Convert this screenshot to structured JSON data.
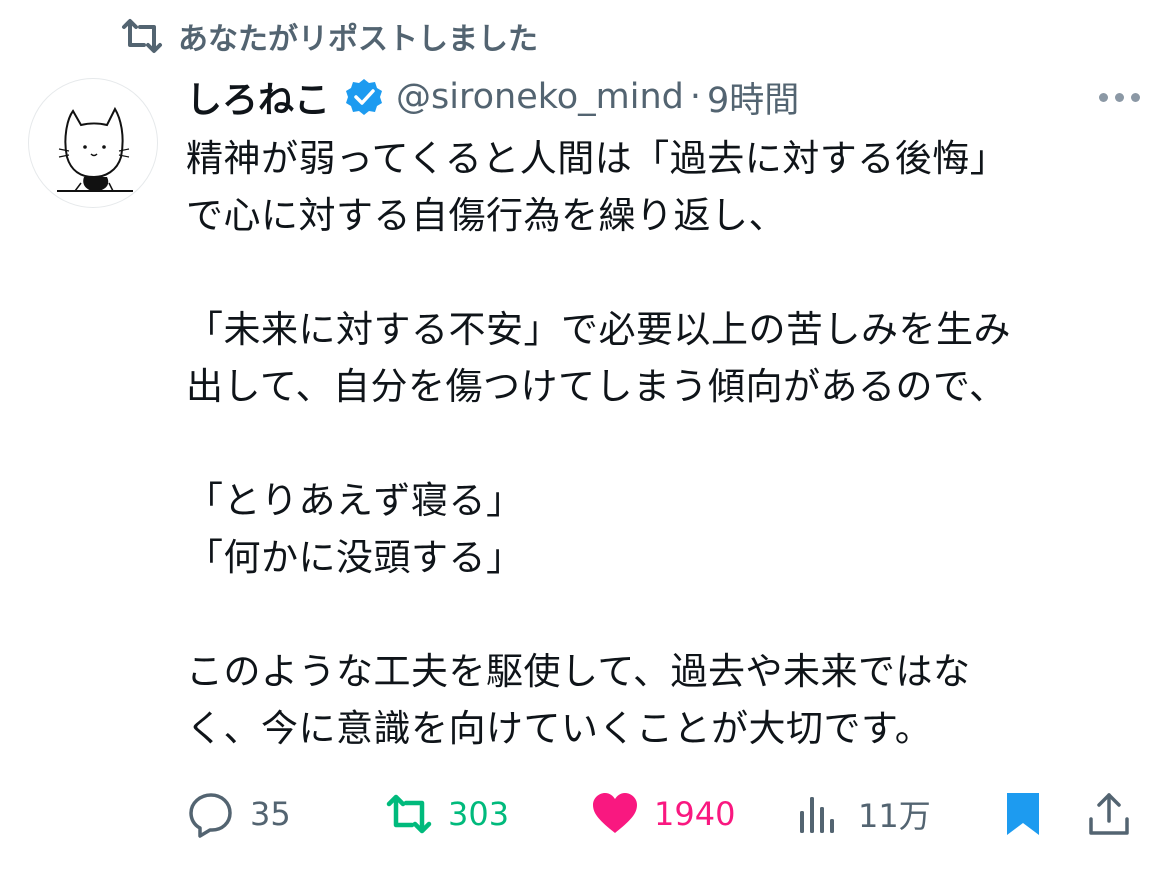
{
  "repost_banner": {
    "text": "あなたがリポストしました",
    "icon": "repost-icon"
  },
  "author": {
    "name": "しろねこ",
    "handle": "@sironeko_mind",
    "separator": "·",
    "time": "9時間",
    "verified": true,
    "avatar": "white-cat-avatar"
  },
  "tweet_text": "精神が弱ってくると人間は「過去に対する後悔」\nで心に対する自傷行為を繰り返し、\n\n「未来に対する不安」で必要以上の苦しみを生み\n出して、自分を傷つけてしまう傾向があるので、\n\n「とりあえず寝る」\n「何かに没頭する」\n\nこのような工夫を駆使して、過去や未来ではな\nく、今に意識を向けていくことが大切です。",
  "actions": {
    "reply_count": "35",
    "repost_count": "303",
    "like_count": "1940",
    "view_count": "11万",
    "bookmarked": true,
    "liked": true,
    "reposted": true
  },
  "colors": {
    "text_primary": "#0f1419",
    "text_secondary": "#536471",
    "verified_blue": "#1d9bf0",
    "repost_green": "#00ba7c",
    "like_pink": "#f91880"
  }
}
